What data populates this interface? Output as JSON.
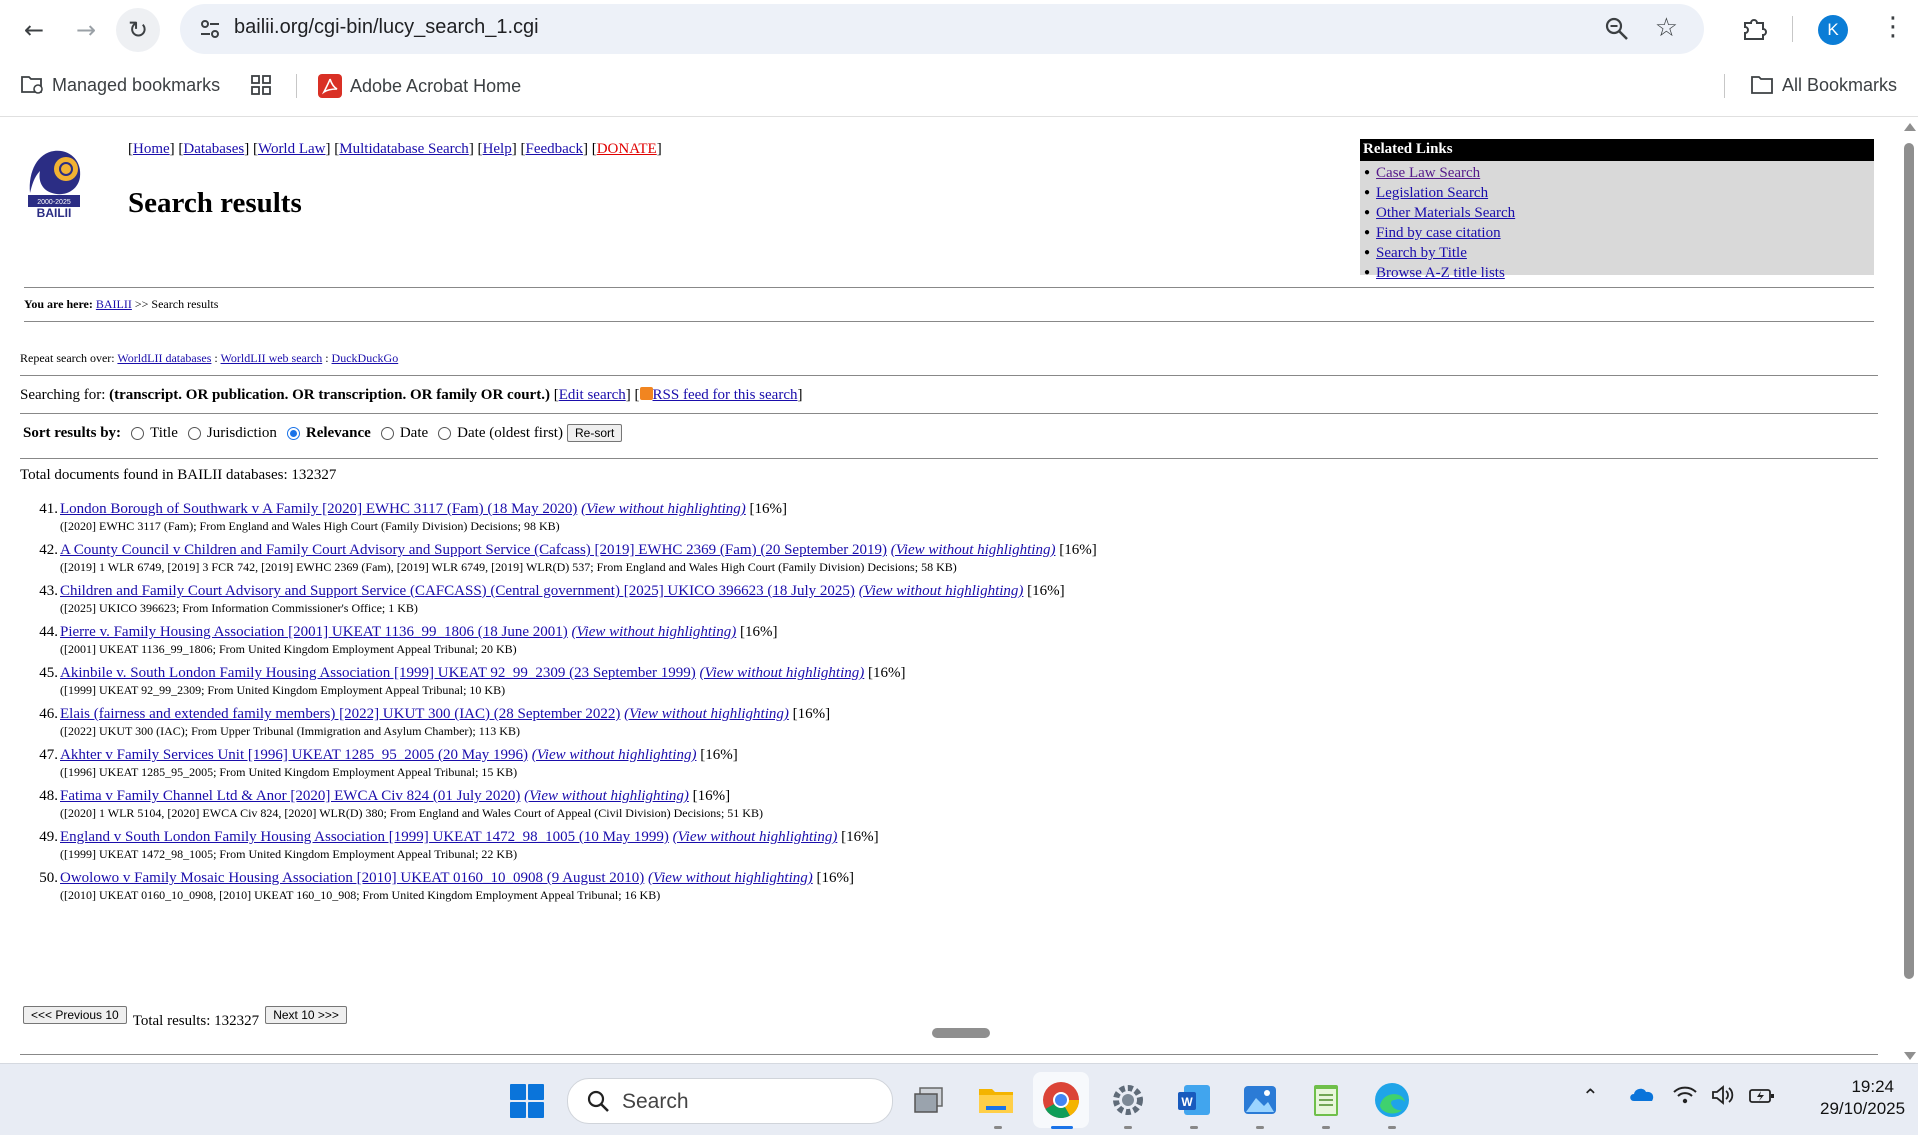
{
  "browser": {
    "url": "bailii.org/cgi-bin/lucy_search_1.cgi",
    "avatar_letter": "K",
    "bookmarks": {
      "managed": "Managed bookmarks",
      "adobe": "Adobe Acrobat Home",
      "all": "All Bookmarks"
    }
  },
  "site": {
    "logo_years": "2000-2025",
    "logo_name": "BAILII",
    "nav": [
      "Home",
      "Databases",
      "World Law",
      "Multidatabase Search",
      "Help",
      "Feedback",
      "DONATE"
    ],
    "title": "Search results",
    "related_head": "Related Links",
    "related_links": [
      "Case Law Search",
      "Legislation Search",
      "Other Materials Search",
      "Find by case citation",
      "Search by Title",
      "Browse A-Z title lists"
    ],
    "breadcrumb_label": "You are here:",
    "breadcrumb_link": "BAILII",
    "breadcrumb_current": ">> Search results",
    "repeat_label": "Repeat search over:",
    "repeat_links": [
      "WorldLII databases",
      "WorldLII web search",
      "DuckDuckGo"
    ],
    "searching_label": "Searching for:",
    "query": "(transcript. OR publication. OR transcription. OR family OR court.)",
    "edit_search": "Edit search",
    "rss": "RSS feed for this search",
    "sort_label": "Sort results by:",
    "sort_options": [
      "Title",
      "Jurisdiction",
      "Relevance",
      "Date",
      "Date (oldest first)"
    ],
    "sort_selected": "Relevance",
    "resort": "Re-sort",
    "total_line": "Total documents found in BAILII databases: 132327",
    "view_without": "(View without highlighting)",
    "results": [
      {
        "n": "41.",
        "title": "London Borough of Southwark v A Family [2020] EWHC 3117 (Fam) (18 May 2020)",
        "score": "[16%]",
        "meta": "([2020] EWHC 3117 (Fam); From England and Wales High Court (Family Division) Decisions; 98 KB)"
      },
      {
        "n": "42.",
        "title": "A County Council v Children and Family Court Advisory and Support Service (Cafcass) [2019] EWHC 2369 (Fam) (20 September 2019)",
        "score": "[16%]",
        "meta": "([2019] 1 WLR 6749, [2019] 3 FCR 742, [2019] EWHC 2369 (Fam), [2019] WLR 6749, [2019] WLR(D) 537; From England and Wales High Court (Family Division) Decisions; 58 KB)"
      },
      {
        "n": "43.",
        "title": "Children and Family Court Advisory and Support Service (CAFCASS) (Central government) [2025] UKICO 396623 (18 July 2025)",
        "score": "[16%]",
        "meta": "([2025] UKICO 396623; From Information Commissioner's Office; 1 KB)"
      },
      {
        "n": "44.",
        "title": "Pierre v. Family Housing Association [2001] UKEAT 1136_99_1806 (18 June 2001)",
        "score": "[16%]",
        "meta": "([2001] UKEAT 1136_99_1806; From United Kingdom Employment Appeal Tribunal; 20 KB)"
      },
      {
        "n": "45.",
        "title": "Akinbile v. South London Family Housing Association [1999] UKEAT 92_99_2309 (23 September 1999)",
        "score": "[16%]",
        "meta": "([1999] UKEAT 92_99_2309; From United Kingdom Employment Appeal Tribunal; 10 KB)"
      },
      {
        "n": "46.",
        "title": "Elais (fairness and extended family members) [2022] UKUT 300 (IAC) (28 September 2022)",
        "score": "[16%]",
        "meta": "([2022] UKUT 300 (IAC); From Upper Tribunal (Immigration and Asylum Chamber); 113 KB)"
      },
      {
        "n": "47.",
        "title": "Akhter v Family Services Unit [1996] UKEAT 1285_95_2005 (20 May 1996)",
        "score": "[16%]",
        "meta": "([1996] UKEAT 1285_95_2005; From United Kingdom Employment Appeal Tribunal; 15 KB)"
      },
      {
        "n": "48.",
        "title": "Fatima v Family Channel Ltd & Anor [2020] EWCA Civ 824 (01 July 2020)",
        "score": "[16%]",
        "meta": "([2020] 1 WLR 5104, [2020] EWCA Civ 824, [2020] WLR(D) 380; From England and Wales Court of Appeal (Civil Division) Decisions; 51 KB)"
      },
      {
        "n": "49.",
        "title": "England v South London Family Housing Association [1999] UKEAT 1472_98_1005 (10 May 1999)",
        "score": "[16%]",
        "meta": "([1999] UKEAT 1472_98_1005; From United Kingdom Employment Appeal Tribunal; 22 KB)"
      },
      {
        "n": "50.",
        "title": "Owolowo v Family Mosaic Housing Association [2010] UKEAT 0160_10_0908 (9 August 2010)",
        "score": "[16%]",
        "meta": "([2010] UKEAT 0160_10_0908, [2010] UKEAT 160_10_908; From United Kingdom Employment Appeal Tribunal; 16 KB)"
      }
    ],
    "prev": "<<< Previous 10",
    "total_results": "Total results: 132327",
    "next": "Next 10 >>>"
  },
  "taskbar": {
    "search_placeholder": "Search",
    "time": "19:24",
    "date": "29/10/2025"
  }
}
